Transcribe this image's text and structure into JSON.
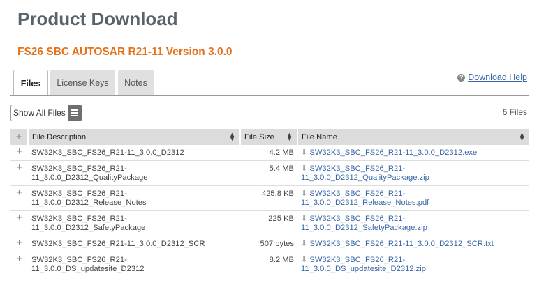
{
  "page_title": "Product Download",
  "product_title": "FS26 SBC AUTOSAR R21-11 Version 3.0.0",
  "tabs": [
    {
      "label": "Files"
    },
    {
      "label": "License Keys"
    },
    {
      "label": "Notes"
    }
  ],
  "help_link": "Download Help",
  "show_all_label": "Show All Files",
  "file_count": "6 Files",
  "columns": {
    "description": "File Description",
    "size": "File Size",
    "name": "File Name"
  },
  "rows": [
    {
      "description": "SW32K3_SBC_FS26_R21-11_3.0.0_D2312",
      "size": "4.2 MB",
      "name": "SW32K3_SBC_FS26_R21-11_3.0.0_D2312.exe"
    },
    {
      "description": "SW32K3_SBC_FS26_R21-11_3.0.0_D2312_QualityPackage",
      "size": "5.4 MB",
      "name": "SW32K3_SBC_FS26_R21-11_3.0.0_D2312_QualityPackage.zip"
    },
    {
      "description": "SW32K3_SBC_FS26_R21-11_3.0.0_D2312_Release_Notes",
      "size": "425.8 KB",
      "name": "SW32K3_SBC_FS26_R21-11_3.0.0_D2312_Release_Notes.pdf"
    },
    {
      "description": "SW32K3_SBC_FS26_R21-11_3.0.0_D2312_SafetyPackage",
      "size": "225 KB",
      "name": "SW32K3_SBC_FS26_R21-11_3.0.0_D2312_SafetyPackage.zip"
    },
    {
      "description": "SW32K3_SBC_FS26_R21-11_3.0.0_D2312_SCR",
      "size": "507 bytes",
      "name": "SW32K3_SBC_FS26_R21-11_3.0.0_D2312_SCR.txt"
    },
    {
      "description": "SW32K3_SBC_FS26_R21-11_3.0.0_DS_updatesite_D2312",
      "size": "8.2 MB",
      "name": "SW32K3_SBC_FS26_R21-11_3.0.0_DS_updatesite_D2312.zip"
    }
  ]
}
